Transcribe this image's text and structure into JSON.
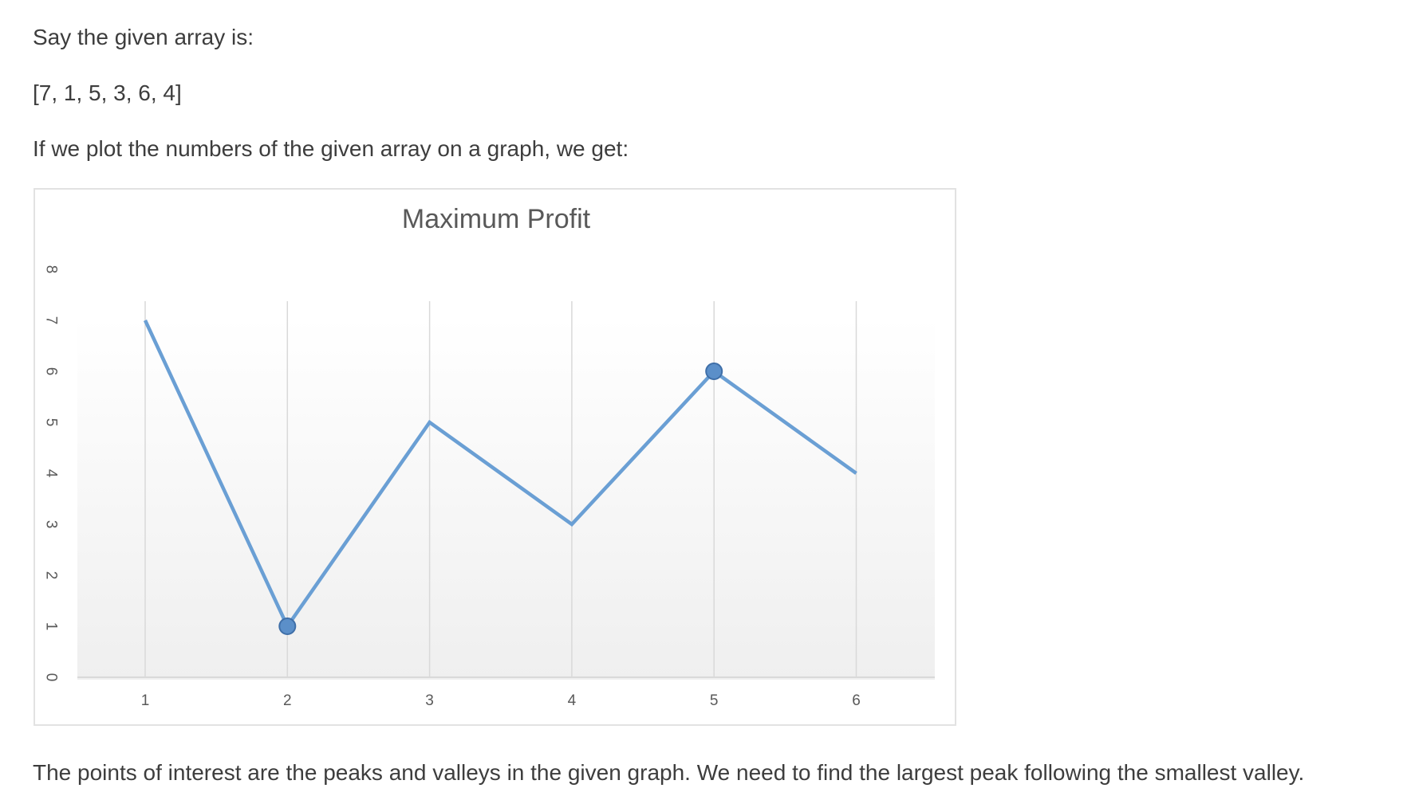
{
  "text": {
    "intro": "Say the given array is:",
    "array": "[7, 1, 5, 3, 6, 4]",
    "plot_intro": "If we plot the numbers of the given array on a graph, we get:",
    "conclusion": "The points of interest are the peaks and valleys in the given graph. We need to find the largest peak following the smallest valley."
  },
  "chart_data": {
    "type": "line",
    "title": "Maximum Profit",
    "xlabel": "",
    "ylabel": "",
    "x": [
      1,
      2,
      3,
      4,
      5,
      6
    ],
    "series": [
      {
        "values": [
          7,
          1,
          5,
          3,
          6,
          4
        ],
        "color": "#6a9fd4"
      }
    ],
    "highlighted_points": [
      {
        "x": 2,
        "y": 1
      },
      {
        "x": 5,
        "y": 6
      }
    ],
    "y_ticks": [
      0,
      1,
      2,
      3,
      4,
      5,
      6,
      7,
      8
    ],
    "x_ticks": [
      1,
      2,
      3,
      4,
      5,
      6
    ],
    "ylim": [
      0,
      8
    ],
    "vertical_gridlines": true,
    "horizontal_gridlines": false,
    "legend": "none",
    "marker_color": "#5b8fc9",
    "marker_stroke": "#3f6fa8",
    "y_tick_labels_rotated": true
  }
}
